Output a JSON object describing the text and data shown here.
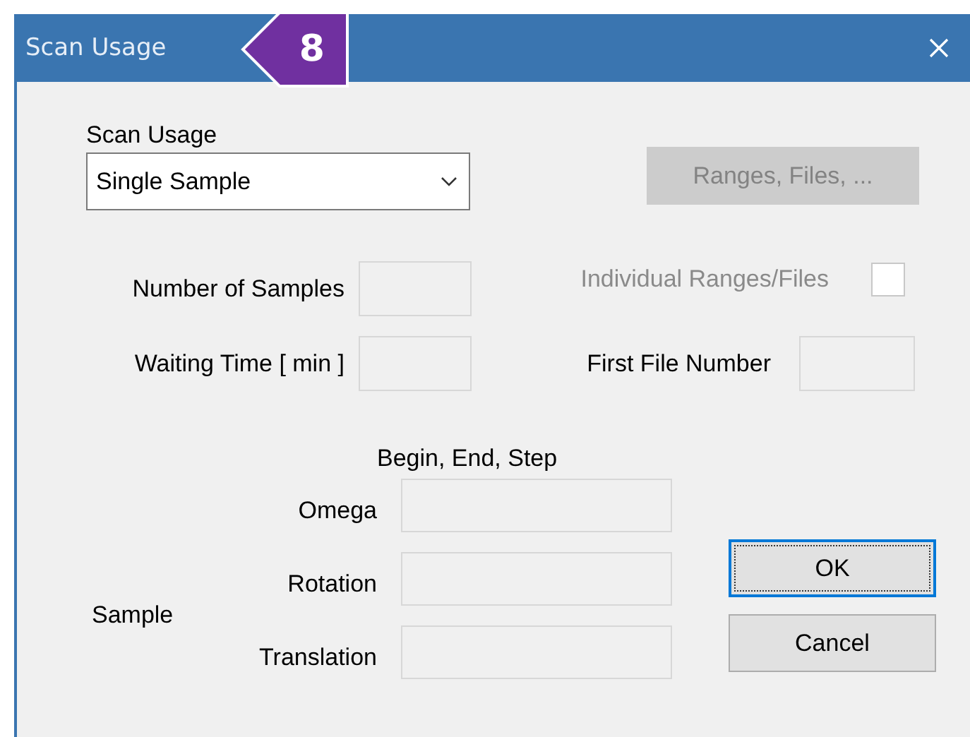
{
  "window": {
    "title": "Scan Usage",
    "badge": "8"
  },
  "scan_usage": {
    "label": "Scan Usage",
    "value": "Single Sample"
  },
  "ranges_button": {
    "label": "Ranges, Files, ...",
    "disabled": true
  },
  "number_of_samples": {
    "label": "Number of Samples",
    "disabled": true
  },
  "individual_ranges": {
    "label": "Individual Ranges/Files",
    "checked": false,
    "disabled": true
  },
  "waiting_time": {
    "label": "Waiting Time [ min ]",
    "disabled": true
  },
  "first_file_number": {
    "label": "First File Number",
    "disabled": true
  },
  "sample": {
    "group_label": "Sample",
    "header": "Begin, End, Step",
    "rows": [
      {
        "label": "Omega",
        "disabled": true
      },
      {
        "label": "Rotation",
        "disabled": true
      },
      {
        "label": "Translation",
        "disabled": true
      }
    ]
  },
  "buttons": [
    {
      "label": "OK",
      "default": true
    },
    {
      "label": "Cancel",
      "default": false
    }
  ]
}
